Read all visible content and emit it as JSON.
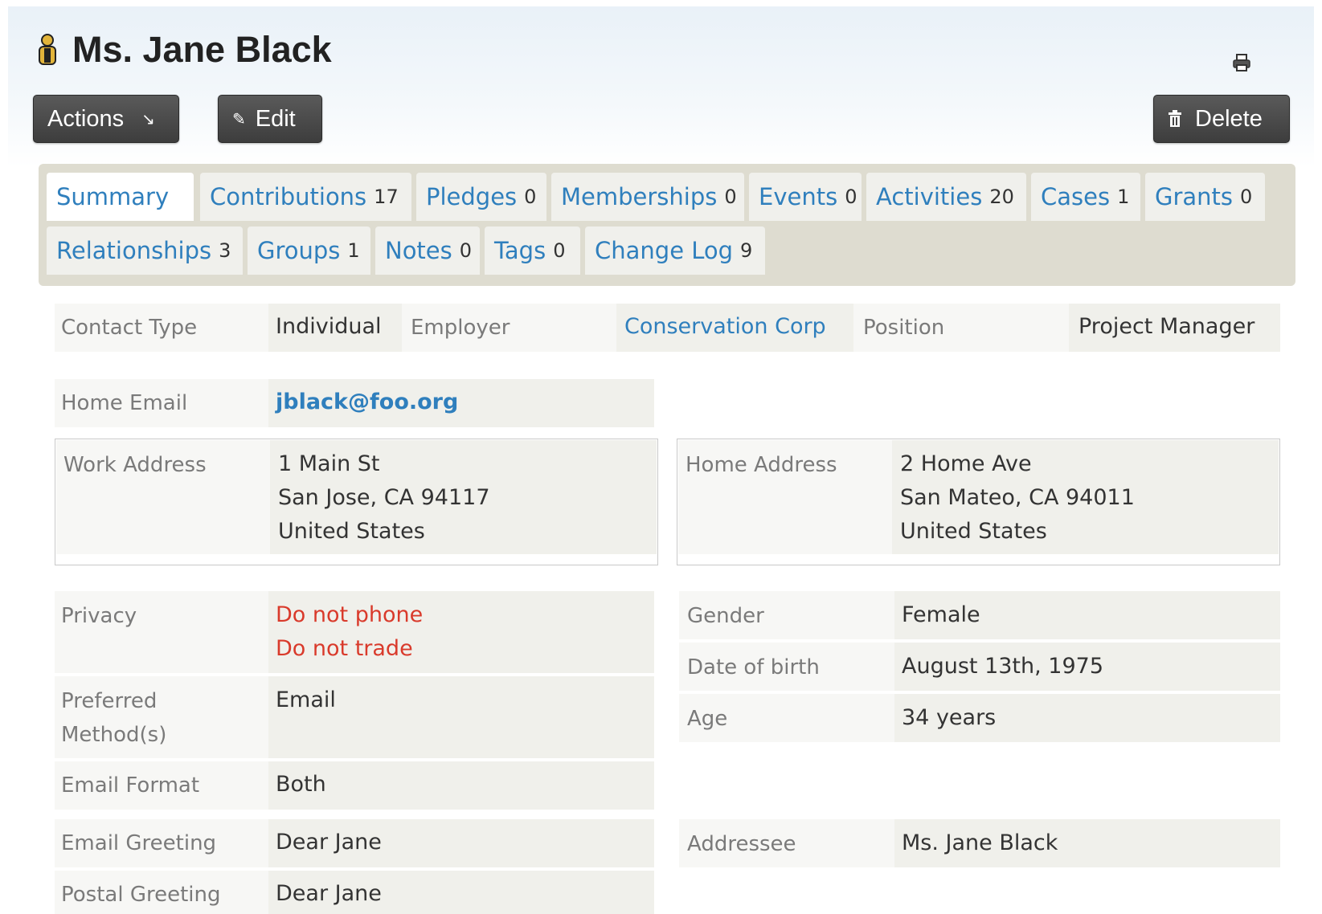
{
  "header": {
    "title": "Ms. Jane Black",
    "icons": {
      "contact": "person-icon",
      "print": "print-icon"
    }
  },
  "toolbar": {
    "actions_label": "Actions",
    "edit_label": "Edit",
    "delete_label": "Delete"
  },
  "tabs": [
    {
      "label": "Summary",
      "count": ""
    },
    {
      "label": "Contributions",
      "count": "17"
    },
    {
      "label": "Pledges",
      "count": "0"
    },
    {
      "label": "Memberships",
      "count": "0"
    },
    {
      "label": "Events",
      "count": "0"
    },
    {
      "label": "Activities",
      "count": "20"
    },
    {
      "label": "Cases",
      "count": "1"
    },
    {
      "label": "Grants",
      "count": "0"
    },
    {
      "label": "Relationships",
      "count": "3"
    },
    {
      "label": "Groups",
      "count": "1"
    },
    {
      "label": "Notes",
      "count": "0"
    },
    {
      "label": "Tags",
      "count": "0"
    },
    {
      "label": "Change Log",
      "count": "9"
    }
  ],
  "contact": {
    "contact_type": {
      "label": "Contact Type",
      "value": "Individual"
    },
    "employer": {
      "label": "Employer",
      "value": "Conservation Corp"
    },
    "position": {
      "label": "Position",
      "value": "Project Manager"
    },
    "home_email": {
      "label": "Home Email",
      "value": "jblack@foo.org"
    },
    "work_address": {
      "label": "Work Address",
      "line1": "1 Main St",
      "line2": "San Jose, CA 94117",
      "line3": "United States"
    },
    "home_address": {
      "label": "Home Address",
      "line1": "2 Home Ave",
      "line2": "San Mateo, CA 94011",
      "line3": "United States"
    },
    "privacy": {
      "label": "Privacy",
      "line1": "Do not phone",
      "line2": "Do not trade"
    },
    "preferred_methods": {
      "label_line1": "Preferred",
      "label_line2": "Method(s)",
      "value": "Email"
    },
    "email_format": {
      "label": "Email Format",
      "value": "Both"
    },
    "email_greeting": {
      "label": "Email Greeting",
      "value": "Dear Jane"
    },
    "postal_greeting": {
      "label": "Postal Greeting",
      "value": "Dear Jane"
    },
    "gender": {
      "label": "Gender",
      "value": "Female"
    },
    "dob": {
      "label": "Date of birth",
      "value": "August 13th, 1975"
    },
    "age": {
      "label": "Age",
      "value": "34 years"
    },
    "addressee": {
      "label": "Addressee",
      "value": "Ms. Jane Black"
    }
  },
  "colors": {
    "link": "#2f7fbd",
    "warning": "#d93a2b",
    "button": "#444444",
    "tab_panel": "#dedcd0"
  }
}
